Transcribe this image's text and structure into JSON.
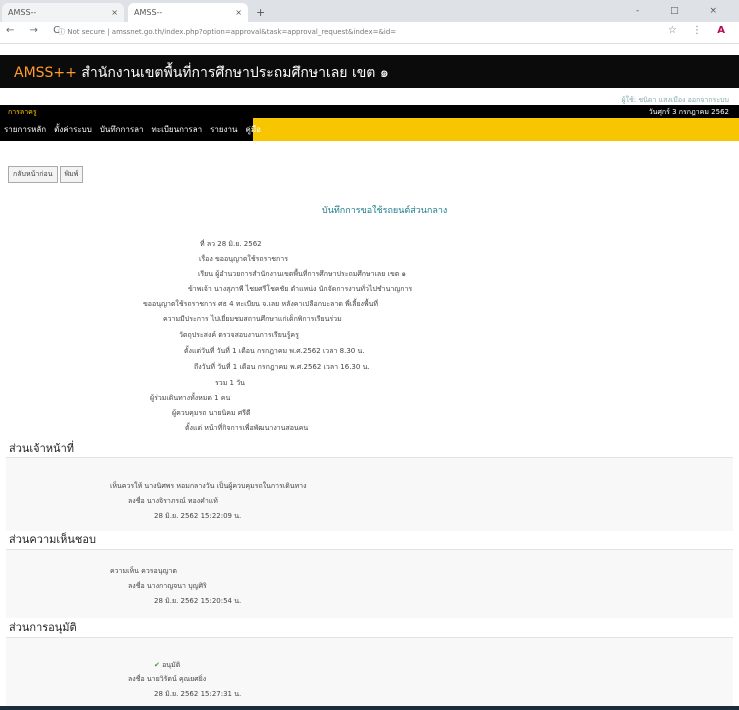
{
  "browser": {
    "tabs": [
      {
        "label": "AMSS-- "
      },
      {
        "label": "AMSS-- "
      }
    ],
    "new_tab": "+",
    "window_controls": "- □ ×",
    "nav": "← → C",
    "url": "ⓘ Not secure | amssnet.go.th/index.php?option=approval&task=approval_request&index=&id=",
    "ext_icons": "☆ ⋮",
    "profile": "A"
  },
  "site": {
    "brand": "AMSS++",
    "title": " สำนักงานเขตพื้นที่การศึกษาประถมศึกษาเลย เขต ๑",
    "user": "ผู้ใช้: ชนิดา แสงเมือง  ออกจากระบบ",
    "module": "การลาครู",
    "date": "วันศุกร์ 3 กรกฎาคม 2562",
    "menu": [
      "รายการหลัก",
      "ตั้งค่าระบบ",
      "บันทึกการลา",
      "ทะเบียนการลา",
      "รายงาน",
      "คู่มือ"
    ]
  },
  "toolbar": {
    "back": "กลับหน้าก่อน",
    "print": "พิมพ์"
  },
  "page": {
    "title": "บันทึกการขอใช้รถยนต์ส่วนกลาง"
  },
  "details": [
    {
      "text": "ที่  ลว 28 มิ.ย. 2562"
    },
    {
      "text": "เรื่อง  ขออนุญาตใช้รถราชการ"
    },
    {
      "text": "เรียน  ผู้อำนวยการสำนักงานเขตพื้นที่การศึกษาประถมศึกษาเลย เขต ๑"
    },
    {
      "text": "ข้าพเจ้า  นางสุภาพี ไชยศรีโชคชัย ตำแหน่ง นักจัดการงานทั่วไปชำนาญการ"
    },
    {
      "text": "ขออนุญาตใช้รถราชการ  ศธ 4 ทะเบียน จ.เลย หลังคาเปลือกบะลาด พี่เลี้ยงพื้นที่"
    },
    {
      "text": "ความมีประการ  ไปเยี่ยมชมสถานศึกษาแก่เด็กพิการเรียนร่วม"
    },
    {
      "text": "วัตถุประสงค์  ตรวจสอบงานการเรียนรู้ครู"
    },
    {
      "text": "ตั้งแต่วันที่  วันที่ 1 เดือน กรกฎาคม พ.ศ.2562 เวลา 8.30 น."
    },
    {
      "text": "ถึงวันที่  วันที่ 1 เดือน กรกฎาคม พ.ศ.2562 เวลา 16.30 น."
    },
    {
      "text": "รวม  1 วัน"
    },
    {
      "text": "ผู้ร่วมเดินทางทั้งหมด  1 คน"
    },
    {
      "text": "ผู้ควบคุมรถ  นายนิคม ศรีดี"
    },
    {
      "text": "ตั้งแต่  หน้าที่กิจการเพื่อพัฒนางานสอนคน"
    }
  ],
  "sections": [
    {
      "title": "ส่วนเจ้าหน้าที่",
      "rows": [
        {
          "text": "เห็นควรให้  นางนิศพร หอมกลางวัน เป็นผู้ควบคุมรถในการเดินทาง"
        },
        {
          "text": "ลงชื่อ  นางจิราภรณ์  ทองคำแท้"
        },
        {
          "text": "28 มิ.ย. 2562 15:22:09 น."
        }
      ]
    },
    {
      "title": "ส่วนความเห็นชอบ",
      "rows": [
        {
          "text": "ความเห็น  ควรอนุญาต"
        },
        {
          "text": "ลงชื่อ  นางกาญจนา  บุญศิริ"
        },
        {
          "text": "28 มิ.ย. 2562 15:20:54 น."
        }
      ]
    },
    {
      "title": "ส่วนการอนุมัติ",
      "rows": [
        {
          "icon": "✔",
          "text": " อนุมัติ"
        },
        {
          "text": "ลงชื่อ  นายวิรัตน์  คุณยศยิ่ง"
        },
        {
          "text": "28 มิ.ย. 2562 15:27:31 น."
        }
      ]
    }
  ]
}
